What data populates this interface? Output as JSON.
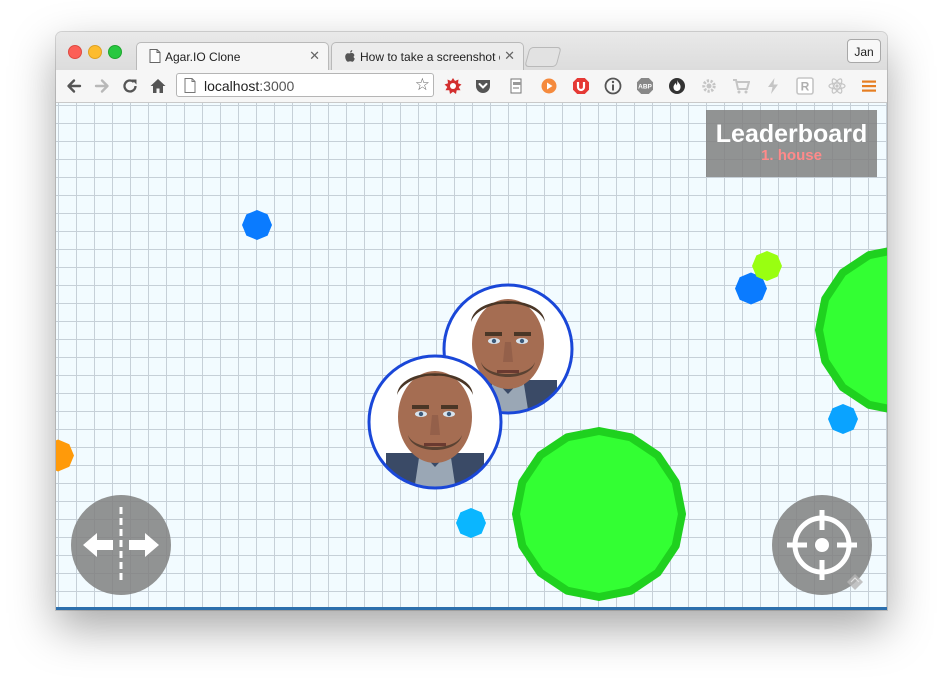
{
  "browser": {
    "tabs": [
      {
        "label": "Agar.IO Clone",
        "active": true,
        "icon": "page-icon"
      },
      {
        "label": "How to take a screenshot o",
        "active": false,
        "icon": "apple-icon"
      }
    ],
    "profile_label": "Jan",
    "url_host": "localhost",
    "url_port": ":3000",
    "extensions": [
      "lastpass-icon",
      "pocket-icon",
      "evernote-icon",
      "play-icon",
      "adblock-u-icon",
      "info-icon",
      "abp-icon",
      "flame-icon",
      "gear-icon",
      "cart-icon",
      "bolt-icon",
      "r-icon",
      "react-icon",
      "menu-icon"
    ]
  },
  "game": {
    "leaderboard": {
      "title": "Leaderboard",
      "entries": [
        "1. house"
      ]
    },
    "colors": {
      "grid_background": "#f2fbff",
      "grid_lines": "#c6d0d8",
      "big_cell": "#33ff33",
      "big_cell_border": "#1fd11f",
      "player_border": "#1a47d8",
      "leaderboard_bg": "#808080",
      "leaderboard_entry": "#ff8a8a"
    },
    "controls": [
      "split-button",
      "target-button"
    ]
  }
}
